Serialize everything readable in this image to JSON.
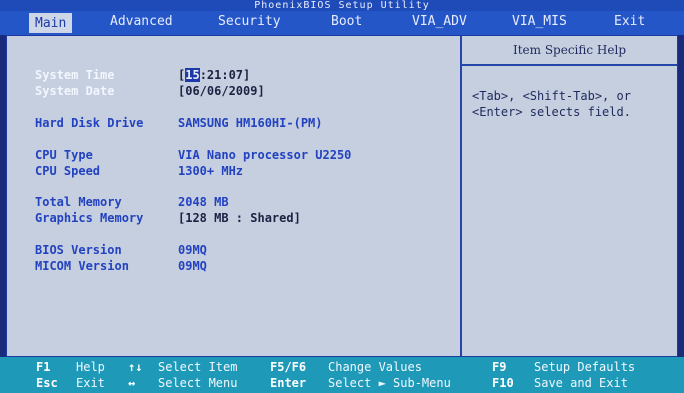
{
  "title": "PhoenixBIOS Setup Utility",
  "menu": {
    "tabs": [
      "Main",
      "Advanced",
      "Security",
      "Boot",
      "VIA_ADV",
      "VIA_MIS",
      "Exit"
    ],
    "active": "Main"
  },
  "main": {
    "system_time": {
      "label": "System Time",
      "value_hour": "15",
      "value_rest": ":21:07]",
      "open_bracket": "["
    },
    "system_date": {
      "label": "System Date",
      "value": "[06/06/2009]"
    },
    "hard_disk": {
      "label": "Hard Disk Drive",
      "value": "SAMSUNG HM160HI-(PM)"
    },
    "cpu_type": {
      "label": "CPU Type",
      "value": "VIA Nano processor U2250"
    },
    "cpu_speed": {
      "label": "CPU Speed",
      "value": "1300+ MHz"
    },
    "total_memory": {
      "label": "Total Memory",
      "value": "2048 MB"
    },
    "graphics_memory": {
      "label": "Graphics Memory",
      "value": "[128 MB : Shared]"
    },
    "bios_version": {
      "label": "BIOS Version",
      "value": "09MQ"
    },
    "micom_version": {
      "label": "MICOM Version",
      "value": "09MQ"
    }
  },
  "help": {
    "title": "Item Specific Help",
    "line1": "<Tab>, <Shift-Tab>, or",
    "line2": "<Enter> selects field."
  },
  "footer": {
    "row1": [
      {
        "key": "F1",
        "text": "Help"
      },
      {
        "key": "↑↓",
        "text": "Select Item"
      },
      {
        "key": "F5/F6",
        "text": "Change Values"
      },
      {
        "key": "F9",
        "text": "Setup Defaults"
      }
    ],
    "row2": [
      {
        "key": "Esc",
        "text": "Exit"
      },
      {
        "key": "↔",
        "text": "Select Menu"
      },
      {
        "key": "Enter",
        "text": "Select ► Sub-Menu"
      },
      {
        "key": "F10",
        "text": "Save and Exit"
      }
    ]
  },
  "colors": {
    "background": "#c5cfdf",
    "menubar": "#2456c8",
    "footer": "#1e9ab8",
    "value_text": "#2342c0"
  }
}
